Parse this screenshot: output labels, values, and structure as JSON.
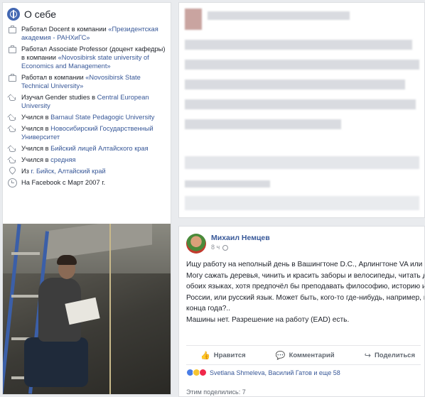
{
  "about": {
    "title": "О себе",
    "items": [
      {
        "icon": "briefcase-icon",
        "prefix": "Работал Docent в компании ",
        "link": "«Президентская академия - РАНХиГС»"
      },
      {
        "icon": "briefcase-icon",
        "prefix": "Работал Associate Professor (доцент кафедры) в компании ",
        "link": "«Novosibirsk state university of Economics and Management»"
      },
      {
        "icon": "briefcase-icon",
        "prefix": "Работал в компании ",
        "link": "«Novosibirsk State Technical University»"
      },
      {
        "icon": "graduation-cap-icon",
        "prefix": "Изучал Gender studies в ",
        "link": "Central European University"
      },
      {
        "icon": "graduation-cap-icon",
        "prefix": "Учился в ",
        "link": "Barnaul State Pedagogic University"
      },
      {
        "icon": "graduation-cap-icon",
        "prefix": "Учился в ",
        "link": "Новосибирский Государственный Университет"
      },
      {
        "icon": "graduation-cap-icon",
        "prefix": "Учился в ",
        "link": "Бийский лицей Алтайского края"
      },
      {
        "icon": "graduation-cap-icon",
        "prefix": "Учился в ",
        "link": "средняя"
      },
      {
        "icon": "location-pin-icon",
        "prefix": "Из ",
        "link": "г. Бийск, Алтайский край"
      },
      {
        "icon": "clock-icon",
        "prefix": "На Facebook с Март 2007 г.",
        "link": ""
      }
    ]
  },
  "post": {
    "author": "Михаил Немцев",
    "time": "8 ч",
    "text": "Ищу работу на неполный день в Вашингтоне D.C., Арлингтоне VA или окрестностях. Могу сажать деревья, чинить и красить заборы и велосипеды, читать детям сказки на обоих языках, хотя предпочёл бы преподавать философию, историю или будущее России, или русский язык. Может быть, кого-то где-нибудь, например, надо заменить до конца года?..\nМашины нет. Разрешение на работу (EAD) есть.",
    "actions": {
      "like": "Нравится",
      "comment": "Комментарий",
      "share": "Поделиться"
    },
    "reactions_text": "Svetlana Shmeleva, Василий Гатов и еще 58",
    "shares_text": "Этим поделились: 7"
  }
}
